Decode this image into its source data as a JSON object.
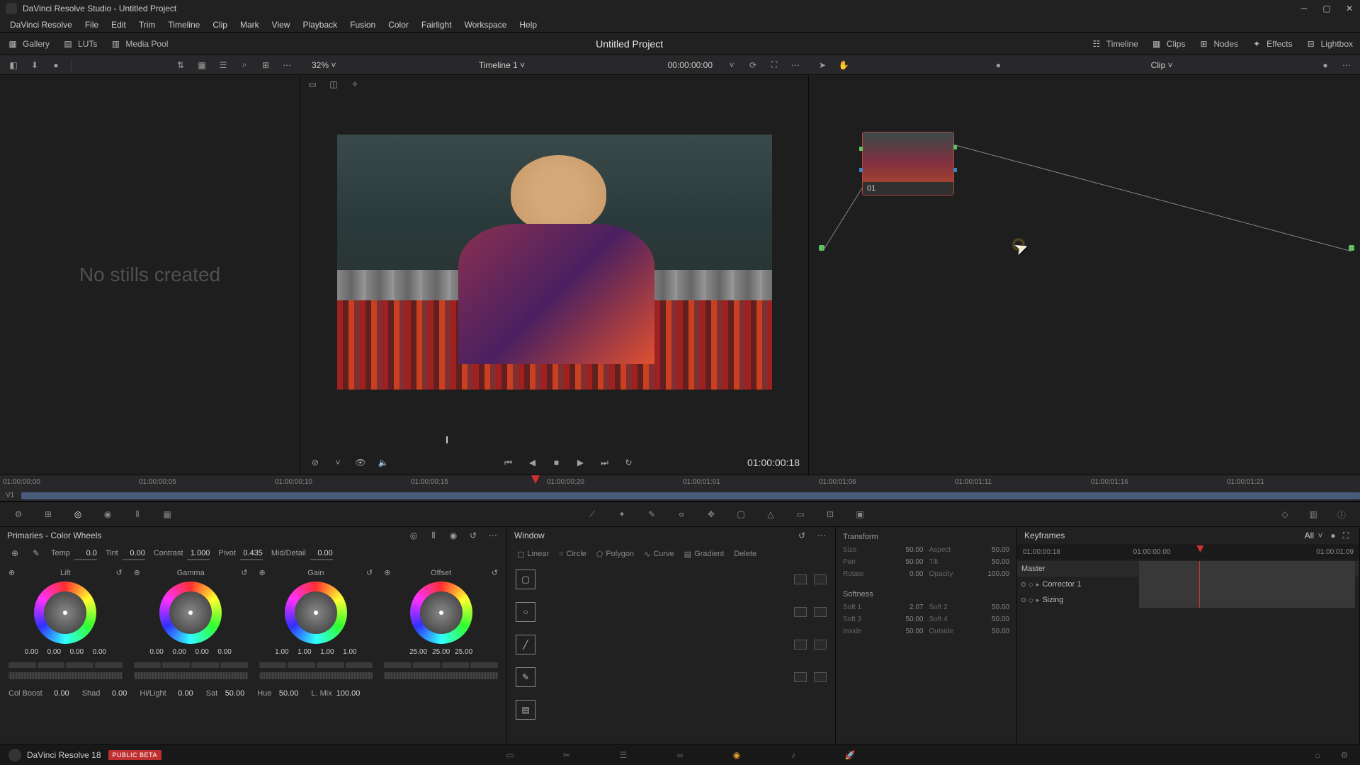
{
  "window": {
    "title": "DaVinci Resolve Studio - Untitled Project"
  },
  "menu": [
    "DaVinci Resolve",
    "File",
    "Edit",
    "Trim",
    "Timeline",
    "Clip",
    "Mark",
    "View",
    "Playback",
    "Fusion",
    "Color",
    "Fairlight",
    "Workspace",
    "Help"
  ],
  "topbar": {
    "project": "Untitled Project",
    "left": [
      {
        "icon": "gallery-icon",
        "label": "Gallery"
      },
      {
        "icon": "luts-icon",
        "label": "LUTs"
      },
      {
        "icon": "media-pool-icon",
        "label": "Media Pool"
      }
    ],
    "right": [
      {
        "icon": "timeline-icon",
        "label": "Timeline"
      },
      {
        "icon": "clips-icon",
        "label": "Clips"
      },
      {
        "icon": "nodes-icon",
        "label": "Nodes"
      },
      {
        "icon": "effects-icon",
        "label": "Effects"
      },
      {
        "icon": "lightbox-icon",
        "label": "Lightbox"
      }
    ]
  },
  "viewer": {
    "zoom": "32%",
    "timeline_name": "Timeline 1",
    "timecode_header": "00:00:00:00",
    "timecode_transport": "01:00:00:18"
  },
  "node_panel": {
    "mode": "Clip",
    "node_label": "01"
  },
  "gallery": {
    "empty": "No stills created"
  },
  "ruler": [
    "01:00:00:00",
    "01:00:00:05",
    "01:00:00:10",
    "01:00:00:15",
    "01:00:00:20",
    "01:00:01:01",
    "01:00:01:06",
    "01:00:01:11",
    "01:00:01:16",
    "01:00:01:21"
  ],
  "track": {
    "label": "V1"
  },
  "primaries": {
    "title": "Primaries - Color Wheels",
    "top_params": [
      {
        "label": "Temp",
        "value": "0.0"
      },
      {
        "label": "Tint",
        "value": "0.00"
      },
      {
        "label": "Contrast",
        "value": "1.000"
      },
      {
        "label": "Pivot",
        "value": "0.435"
      },
      {
        "label": "Mid/Detail",
        "value": "0.00"
      }
    ],
    "wheels": [
      {
        "name": "Lift",
        "vals": [
          "0.00",
          "0.00",
          "0.00",
          "0.00"
        ]
      },
      {
        "name": "Gamma",
        "vals": [
          "0.00",
          "0.00",
          "0.00",
          "0.00"
        ]
      },
      {
        "name": "Gain",
        "vals": [
          "1.00",
          "1.00",
          "1.00",
          "1.00"
        ]
      },
      {
        "name": "Offset",
        "vals": [
          "25.00",
          "25.00",
          "25.00"
        ]
      }
    ],
    "bottom_params": [
      {
        "label": "Col Boost",
        "value": "0.00"
      },
      {
        "label": "Shad",
        "value": "0.00"
      },
      {
        "label": "Hi/Light",
        "value": "0.00"
      },
      {
        "label": "Sat",
        "value": "50.00"
      },
      {
        "label": "Hue",
        "value": "50.00"
      },
      {
        "label": "L. Mix",
        "value": "100.00"
      }
    ]
  },
  "window_panel": {
    "title": "Window",
    "tabs": [
      "Linear",
      "Circle",
      "Polygon",
      "Curve",
      "Gradient",
      "Delete"
    ]
  },
  "transform": {
    "title": "Transform",
    "rows": [
      [
        {
          "l": "Size",
          "v": "50.00"
        },
        {
          "l": "Aspect",
          "v": "50.00"
        }
      ],
      [
        {
          "l": "Pan",
          "v": "50.00"
        },
        {
          "l": "Tilt",
          "v": "50.00"
        }
      ],
      [
        {
          "l": "Rotate",
          "v": "0.00"
        },
        {
          "l": "Opacity",
          "v": "100.00"
        }
      ]
    ],
    "softness_title": "Softness",
    "softness": [
      [
        {
          "l": "Soft 1",
          "v": "2.07"
        },
        {
          "l": "Soft 2",
          "v": "50.00"
        }
      ],
      [
        {
          "l": "Soft 3",
          "v": "50.00"
        },
        {
          "l": "Soft 4",
          "v": "50.00"
        }
      ],
      [
        {
          "l": "Inside",
          "v": "50.00"
        },
        {
          "l": "Outside",
          "v": "50.00"
        }
      ]
    ]
  },
  "keyframes": {
    "title": "Keyframes",
    "filter": "All",
    "tc": [
      "01:00:00:18",
      "01:00:00:00",
      "01:00:01:09"
    ],
    "rows": [
      "Master",
      "Corrector 1",
      "Sizing"
    ]
  },
  "status": {
    "app": "DaVinci Resolve 18",
    "badge": "PUBLIC BETA"
  }
}
